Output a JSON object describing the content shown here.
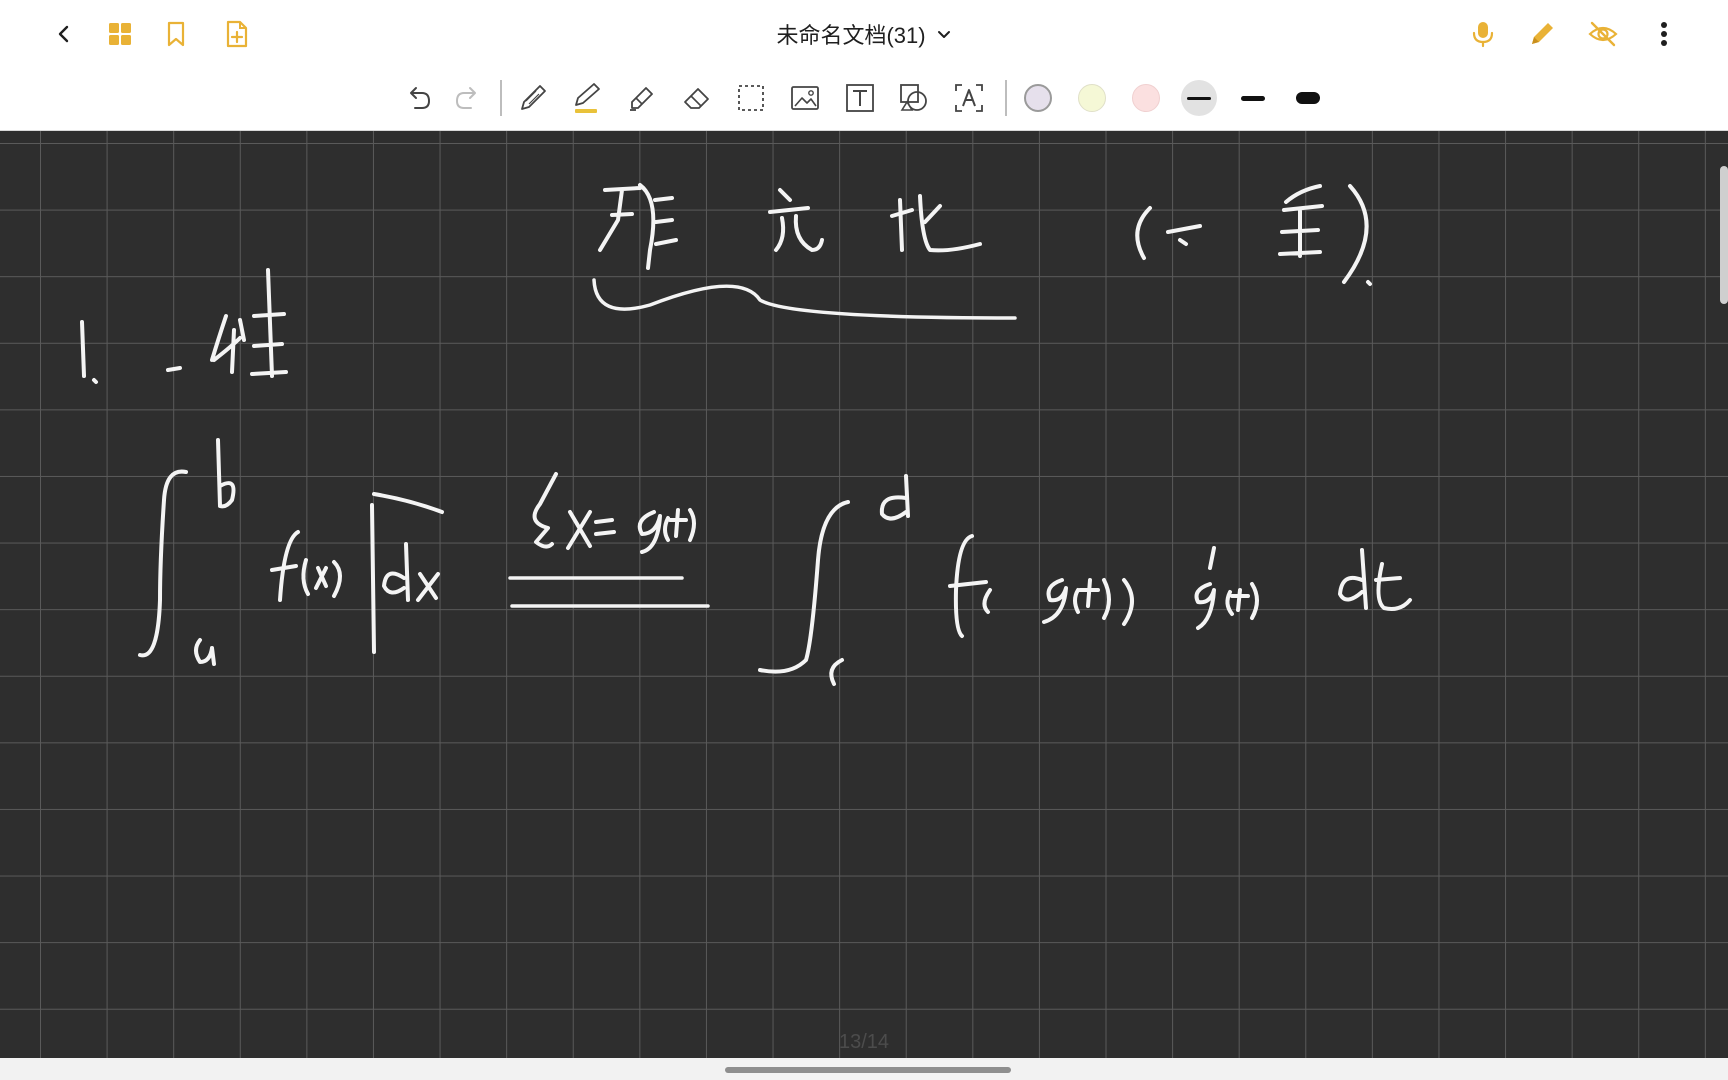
{
  "document": {
    "title": "未命名文档(31)",
    "page_indicator": "13/14"
  },
  "titlebar": {
    "left_icons": [
      "back-icon",
      "grid-icon",
      "bookmark-icon",
      "add-page-icon"
    ],
    "right_icons": [
      "microphone-icon",
      "pen-icon",
      "hide-icon",
      "more-icon"
    ],
    "accent_color": "#E9B236"
  },
  "toolbar": {
    "tools": [
      "undo-icon",
      "redo-icon",
      "pencil-icon",
      "pen-icon",
      "marker-icon",
      "eraser-icon",
      "lasso-select-icon",
      "image-icon",
      "text-icon",
      "shape-icon",
      "text-recognition-icon"
    ],
    "colors": [
      "#E6E0EC",
      "#F5F8D6",
      "#FBE0E0"
    ],
    "stroke_widths": [
      "thin",
      "medium",
      "thick"
    ],
    "selected_stroke": "thin"
  }
}
